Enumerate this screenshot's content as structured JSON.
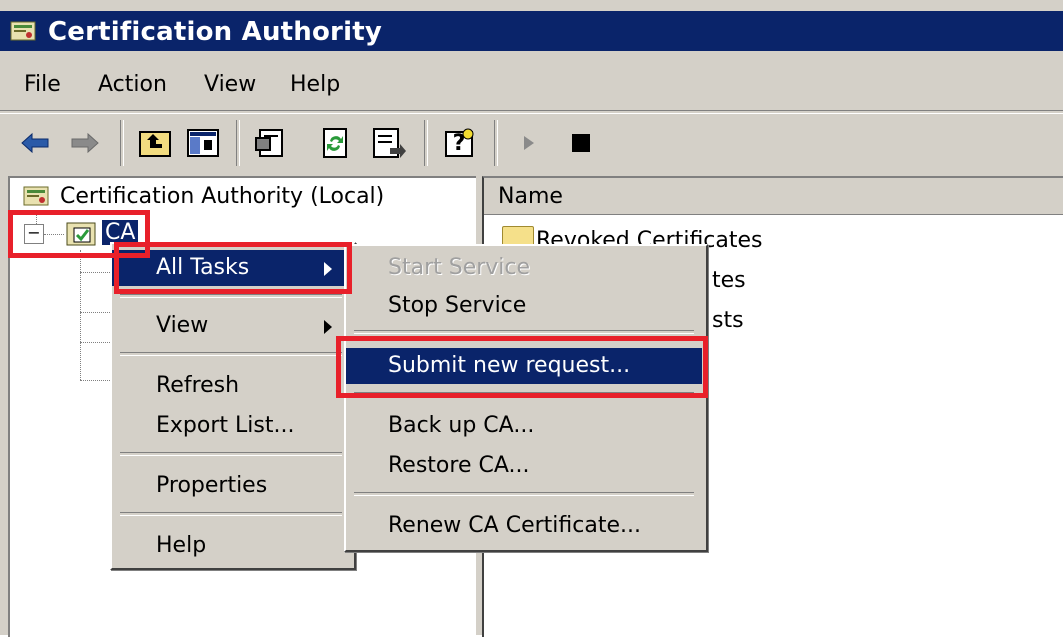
{
  "window": {
    "title": "Certification Authority",
    "icon": "certificate-authority-icon",
    "title_bar_color": "#0a246a"
  },
  "menubar": {
    "items": [
      "File",
      "Action",
      "View",
      "Help"
    ]
  },
  "toolbar": {
    "buttons": [
      "back-arrow-icon",
      "forward-arrow-icon",
      "up-folder-icon",
      "show-hide-tree-icon",
      "properties-icon",
      "refresh-icon",
      "export-list-icon",
      "help-icon",
      "play-icon",
      "stop-icon"
    ]
  },
  "tree": {
    "root": "Certification Authority (Local)",
    "node": "CA",
    "expander": "−"
  },
  "list": {
    "column_name": "Name",
    "items": [
      "Revoked Certificates",
      "tes",
      "sts"
    ]
  },
  "context_menu": {
    "items": [
      {
        "label": "All Tasks",
        "has_submenu": true,
        "selected": true
      },
      {
        "label": "View",
        "has_submenu": true
      },
      {
        "label": "Refresh"
      },
      {
        "label": "Export List..."
      },
      {
        "label": "Properties"
      },
      {
        "label": "Help"
      }
    ]
  },
  "submenu": {
    "items": [
      {
        "label": "Start Service",
        "disabled": true
      },
      {
        "label": "Stop Service"
      },
      {
        "label": "Submit new request...",
        "selected": true
      },
      {
        "label": "Back up CA..."
      },
      {
        "label": "Restore CA..."
      },
      {
        "label": "Renew CA Certificate..."
      }
    ]
  },
  "colors": {
    "selection": "#0a246a",
    "highlight_box": "#e8202a",
    "chrome": "#d4d0c8"
  }
}
